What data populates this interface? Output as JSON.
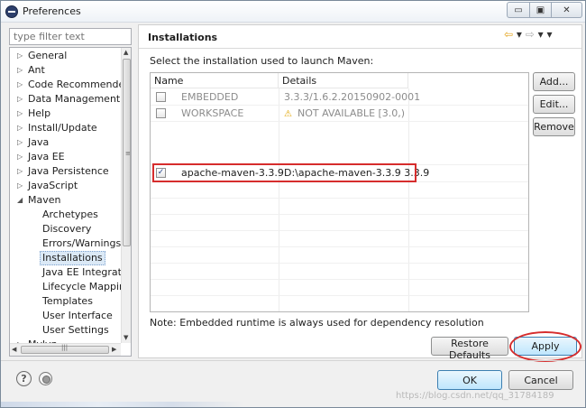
{
  "window": {
    "title": "Preferences",
    "buttons": {
      "minimize": "▭",
      "maximize": "▣",
      "close": "✕"
    }
  },
  "sidebar": {
    "filter_placeholder": "type filter text",
    "items": [
      {
        "label": "General",
        "expand": "▷"
      },
      {
        "label": "Ant",
        "expand": "▷"
      },
      {
        "label": "Code Recommenders",
        "expand": "▷"
      },
      {
        "label": "Data Management",
        "expand": "▷"
      },
      {
        "label": "Help",
        "expand": "▷"
      },
      {
        "label": "Install/Update",
        "expand": "▷"
      },
      {
        "label": "Java",
        "expand": "▷"
      },
      {
        "label": "Java EE",
        "expand": "▷"
      },
      {
        "label": "Java Persistence",
        "expand": "▷"
      },
      {
        "label": "JavaScript",
        "expand": "▷"
      },
      {
        "label": "Maven",
        "expand": "◢"
      },
      {
        "label": "Archetypes"
      },
      {
        "label": "Discovery"
      },
      {
        "label": "Errors/Warnings"
      },
      {
        "label": "Installations",
        "selected": true
      },
      {
        "label": "Java EE Integration"
      },
      {
        "label": "Lifecycle Mapping"
      },
      {
        "label": "Templates"
      },
      {
        "label": "User Interface"
      },
      {
        "label": "User Settings"
      },
      {
        "label": "Mylyn",
        "expand": "▷"
      }
    ]
  },
  "page": {
    "title": "Installations",
    "nav": {
      "back": "⇦",
      "back_menu": "▾",
      "forward": "⇨",
      "forward_menu": "▾",
      "view_menu": "▾"
    },
    "description": "Select the installation used to launch Maven:",
    "table": {
      "columns": [
        "Name",
        "Details"
      ],
      "rows": [
        {
          "name": "EMBEDDED",
          "details": "3.3.3/1.6.2.20150902-0001",
          "checked": "",
          "disabled": true,
          "warning": ""
        },
        {
          "name": "WORKSPACE",
          "details": "NOT AVAILABLE [3.0,)",
          "checked": "",
          "disabled": true,
          "warning": "⚠"
        },
        {
          "name": "apache-maven-3.3.9",
          "details": "D:\\apache-maven-3.3.9 3.3.9",
          "checked": "✓",
          "disabled": false,
          "warning": ""
        }
      ]
    },
    "side_buttons": {
      "add": "Add...",
      "edit": "Edit...",
      "remove": "Remove"
    },
    "note": "Note: Embedded runtime is always used for dependency resolution",
    "restore_defaults": "Restore Defaults",
    "apply": "Apply"
  },
  "footer": {
    "help_icon": "?",
    "ok": "OK",
    "cancel": "Cancel",
    "watermark": "https://blog.csdn.net/qq_31784189"
  },
  "colors": {
    "highlight": "#d62d2d",
    "default_button": "#bee6fd",
    "selection": "#dbe9f6"
  }
}
